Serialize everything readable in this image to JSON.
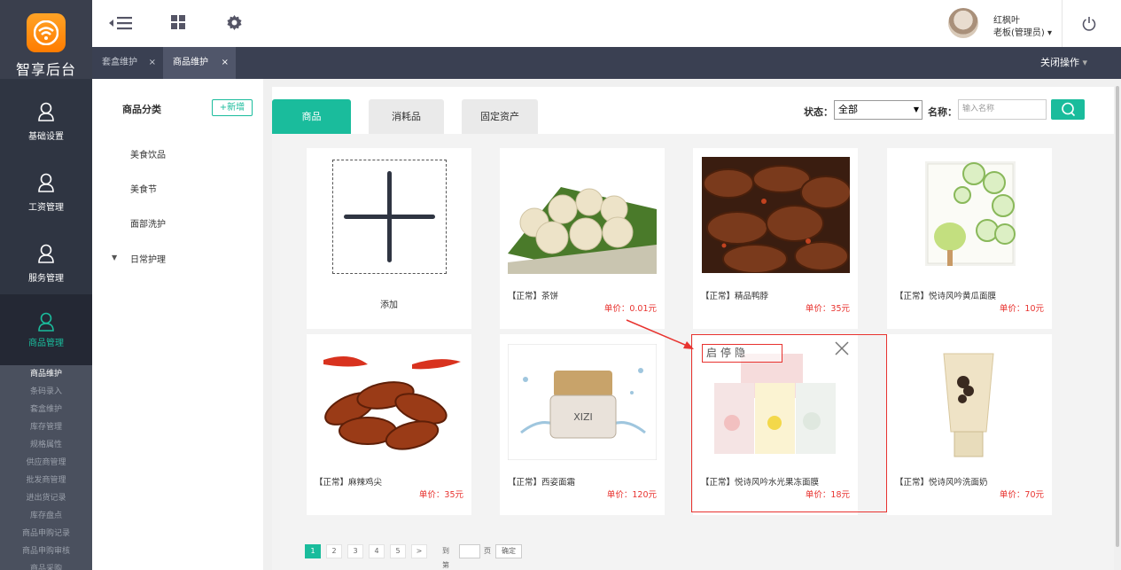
{
  "brand": {
    "name": "智享后台",
    "accent": "#1abc9c"
  },
  "sidebar": {
    "items": [
      {
        "label": "基础设置",
        "icon": "user-icon"
      },
      {
        "label": "工资管理",
        "icon": "user-icon"
      },
      {
        "label": "服务管理",
        "icon": "user-icon"
      },
      {
        "label": "商品管理",
        "icon": "user-icon",
        "active": true
      }
    ],
    "subitems": [
      "商品维护",
      "条码录入",
      "套盒维护",
      "库存管理",
      "规格属性",
      "供应商管理",
      "批发商管理",
      "进出货记录",
      "库存盘点",
      "商品申购记录",
      "商品申购审核",
      "商品采购"
    ]
  },
  "topbar": {
    "user_name": "红枫叶",
    "user_role": "老板(管理员)"
  },
  "tabs": [
    {
      "label": "套盒维护",
      "close": "×"
    },
    {
      "label": "商品维护",
      "close": "×",
      "active": true
    }
  ],
  "close_ops": "关闭操作",
  "category_panel": {
    "title": "商品分类",
    "add_label": "+新增",
    "items": [
      "美食饮品",
      "美食节",
      "面部洗护",
      "日常护理"
    ]
  },
  "main": {
    "tabs": [
      "商品",
      "消耗品",
      "固定资产"
    ],
    "status_label": "状态：",
    "status_value": "全部",
    "name_label": "名称：",
    "name_placeholder": "输入名称",
    "add_label": "添加",
    "ops_label": "启停隐"
  },
  "products": [
    {
      "name": "【正常】茶饼",
      "price": "单价：0.01元"
    },
    {
      "name": "【正常】精品鸭脖",
      "price": "单价：35元"
    },
    {
      "name": "【正常】悦诗风吟黄瓜面膜",
      "price": "单价：10元"
    },
    {
      "name": "【正常】麻辣鸡尖",
      "price": "单价：35元"
    },
    {
      "name": "【正常】西姿面霜",
      "price": "单价：120元"
    },
    {
      "name": "【正常】悦诗风吟水光果冻面膜",
      "price": "单价：18元"
    },
    {
      "name": "【正常】悦诗风吟洗面奶",
      "price": "单价：70元"
    }
  ],
  "pager": {
    "pages": [
      "1",
      "2",
      "3",
      "4",
      "5",
      ">"
    ],
    "goto_label": "到第",
    "page_label": "页",
    "ok_label": "确定"
  }
}
